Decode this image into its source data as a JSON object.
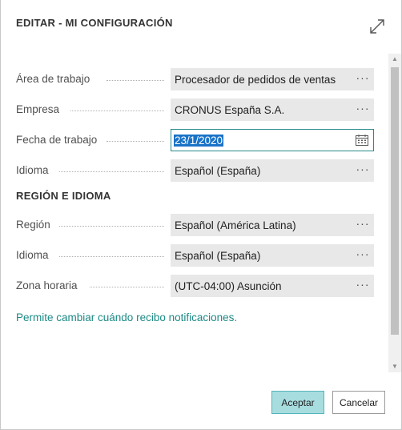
{
  "dialog": {
    "title": "EDITAR - MI CONFIGURACIÓN"
  },
  "fields": {
    "area": {
      "label": "Área de trabajo",
      "value": "Procesador de pedidos de ventas"
    },
    "empresa": {
      "label": "Empresa",
      "value": "CRONUS España S.A."
    },
    "fecha": {
      "label": "Fecha de trabajo",
      "value": "23/1/2020"
    },
    "idioma": {
      "label": "Idioma",
      "value": "Español (España)"
    }
  },
  "region_section": {
    "title": "REGIÓN E IDIOMA",
    "region": {
      "label": "Región",
      "value": "Español (América Latina)"
    },
    "idioma": {
      "label": "Idioma",
      "value": "Español (España)"
    },
    "zona": {
      "label": "Zona horaria",
      "value": "(UTC-04:00) Asunción"
    }
  },
  "notifications_link": "Permite cambiar cuándo recibo notificaciones.",
  "icons": {
    "ellipsis": "···",
    "expand": "expand-icon",
    "calendar": "calendar-icon",
    "scroll_up": "▲",
    "scroll_down": "▼"
  },
  "buttons": {
    "accept": "Aceptar",
    "cancel": "Cancelar"
  },
  "colors": {
    "accent": "#1c8a86",
    "accept_bg": "#a8dde0",
    "selection": "#1a73c8"
  }
}
